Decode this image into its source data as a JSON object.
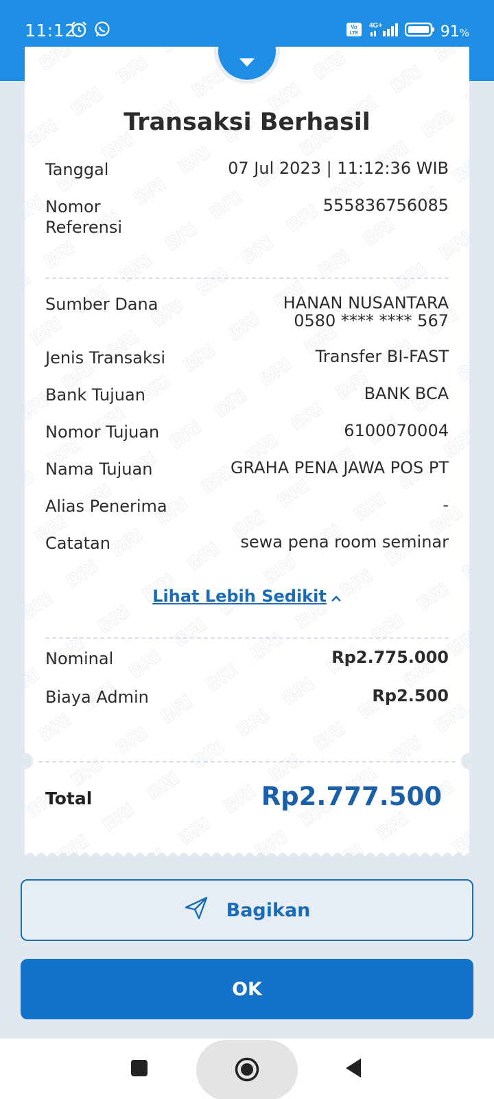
{
  "status_bar": {
    "time": "11:12",
    "network": "4G+",
    "volte": "Vo LTE",
    "battery": "91",
    "battery_unit": "%"
  },
  "receipt": {
    "title": "Transaksi Berhasil",
    "tanggal": {
      "label": "Tanggal",
      "value": "07 Jul 2023 | 11:12:36 WIB"
    },
    "nomor_referensi": {
      "label_line1": "Nomor",
      "label_line2": "Referensi",
      "value": "555836756085"
    },
    "sumber_dana": {
      "label": "Sumber Dana",
      "name": "HANAN NUSANTARA",
      "account": "0580 **** **** 567"
    },
    "jenis_transaksi": {
      "label": "Jenis Transaksi",
      "value": "Transfer BI-FAST"
    },
    "bank_tujuan": {
      "label": "Bank Tujuan",
      "value": "BANK BCA"
    },
    "nomor_tujuan": {
      "label": "Nomor Tujuan",
      "value": "6100070004"
    },
    "nama_tujuan": {
      "label": "Nama Tujuan",
      "value": "GRAHA PENA JAWA POS PT"
    },
    "alias_penerima": {
      "label": "Alias Penerima",
      "value": "-"
    },
    "catatan": {
      "label": "Catatan",
      "value": "sewa pena room seminar"
    },
    "toggle_link": "Lihat Lebih Sedikit",
    "nominal": {
      "label": "Nominal",
      "value": "Rp2.775.000"
    },
    "biaya_admin": {
      "label": "Biaya Admin",
      "value": "Rp2.500"
    },
    "total": {
      "label": "Total",
      "value": "Rp2.777.500"
    },
    "watermark_text": "BRI"
  },
  "actions": {
    "share_label": "Bagikan",
    "ok_label": "OK"
  },
  "colors": {
    "brand_blue": "#1e8fe4",
    "button_blue": "#1472c9",
    "total_blue": "#1a5fa8",
    "link_blue": "#1a6cb4"
  },
  "icons": {
    "status": [
      "alarm-icon",
      "whatsapp-icon",
      "signal-icon",
      "battery-icon"
    ],
    "share": "send-icon",
    "nav": [
      "recent-apps-icon",
      "home-icon",
      "back-icon"
    ]
  }
}
